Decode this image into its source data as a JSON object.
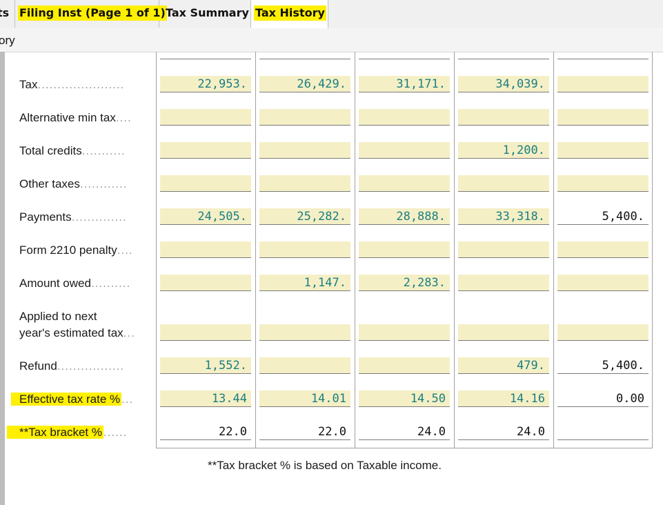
{
  "tabs": [
    {
      "label": "ts",
      "highlight": false
    },
    {
      "label": "Filing Inst (Page 1 of 1)",
      "highlight": true
    },
    {
      "label": "Tax Summary",
      "highlight": false
    },
    {
      "label": "Tax History",
      "highlight": true,
      "active": true
    }
  ],
  "subheader": {
    "title": "ory"
  },
  "rows": [
    {
      "label": "Tax",
      "dots": "......................",
      "values": [
        "22,953.",
        "26,429.",
        "31,171.",
        "34,039.",
        ""
      ]
    },
    {
      "label": "Alternative min tax",
      "dots": "....",
      "values": [
        "",
        "",
        "",
        "",
        ""
      ]
    },
    {
      "label": "Total credits",
      "dots": "...........",
      "values": [
        "",
        "",
        "",
        "1,200.",
        ""
      ]
    },
    {
      "label": "Other taxes",
      "dots": "............",
      "values": [
        "",
        "",
        "",
        "",
        ""
      ]
    },
    {
      "label": "Payments",
      "dots": "..............",
      "values": [
        "24,505.",
        "25,282.",
        "28,888.",
        "33,318.",
        "5,400."
      ]
    },
    {
      "label": "Form 2210 penalty",
      "dots": "....",
      "values": [
        "",
        "",
        "",
        "",
        ""
      ]
    },
    {
      "label": "Amount owed",
      "dots": "..........",
      "values": [
        "",
        "1,147.",
        "2,283.",
        "",
        ""
      ]
    },
    {
      "label_line1": "Applied to next",
      "label_line2": "year's estimated tax",
      "dots": "...",
      "values": [
        "",
        "",
        "",
        "",
        ""
      ]
    },
    {
      "label": "Refund",
      "dots": ".................",
      "values": [
        "1,552.",
        "",
        "",
        "479.",
        "5,400."
      ]
    },
    {
      "label": "Effective tax rate %",
      "dots": "...",
      "values": [
        "13.44",
        "14.01",
        "14.50",
        "14.16",
        "0.00"
      ]
    },
    {
      "label": "**Tax bracket %",
      "dots": "......",
      "values": [
        "22.0",
        "22.0",
        "24.0",
        "24.0",
        ""
      ]
    }
  ],
  "footnote": "**Tax bracket % is based on Taxable income.",
  "colors": {
    "highlight": "#ffef00",
    "cell_fill": "#f5efc6",
    "value_teal": "#1a7f80"
  }
}
